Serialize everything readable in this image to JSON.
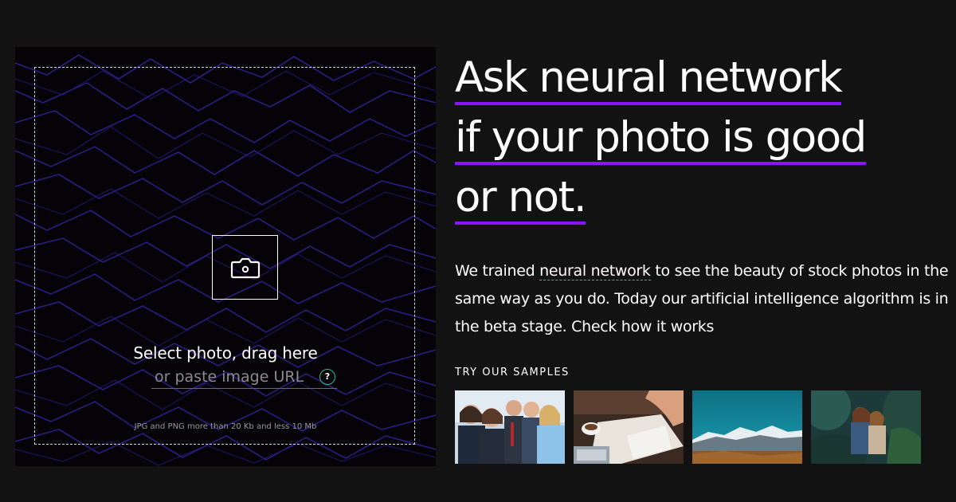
{
  "upload": {
    "select_label": "Select photo, drag here",
    "url_placeholder": "or paste image URL",
    "help_label": "?",
    "hint": "JPG and PNG more than 20 Kb and less 10 Mb",
    "camera_icon": "camera-icon"
  },
  "hero": {
    "headline_line1": "Ask neural network",
    "headline_line2": "if your photo is good",
    "headline_line3": "or not.",
    "description_before": "We trained ",
    "description_link": "neural network",
    "description_after": " to see the beauty of stock photos in the same way as you do. Today our artificial intelligence algorithm is in the beta stage. Check how it works"
  },
  "samples": {
    "title": "TRY OUR SAMPLES",
    "items": [
      {
        "subject": "business-team-photo"
      },
      {
        "subject": "desk-work-photo"
      },
      {
        "subject": "mountains-lake-photo"
      },
      {
        "subject": "couple-forest-photo"
      }
    ]
  },
  "colors": {
    "background": "#121212",
    "accent_purple": "#8a14ff",
    "accent_green": "#2fbf84",
    "panel": "#050308"
  }
}
